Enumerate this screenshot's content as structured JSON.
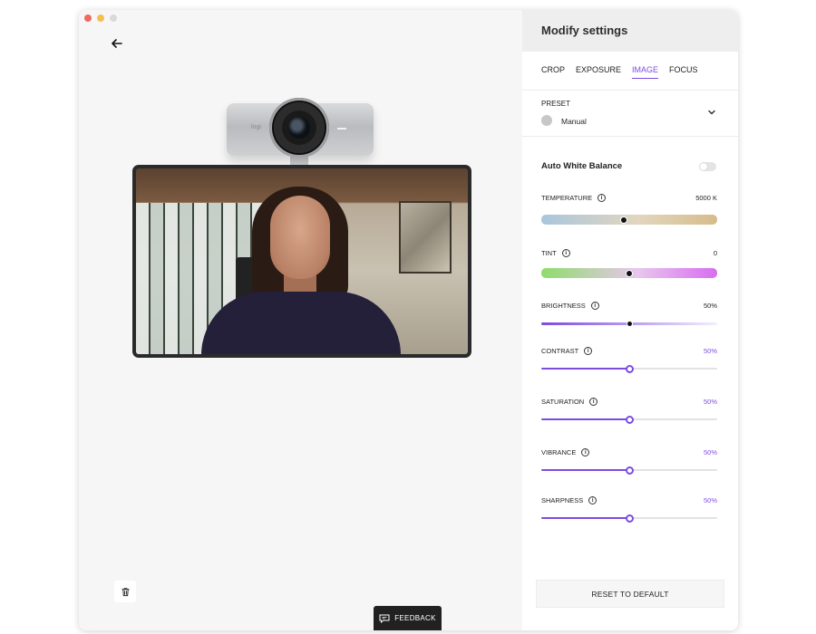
{
  "window": {
    "traffic_colors": [
      "#ec6a5e",
      "#f4bf4f",
      "#d9d9d9"
    ]
  },
  "preview": {
    "camera_logo": "logi",
    "feedback_label": "FEEDBACK"
  },
  "panel": {
    "title": "Modify settings",
    "tabs": [
      {
        "label": "CROP",
        "active": false
      },
      {
        "label": "EXPOSURE",
        "active": false
      },
      {
        "label": "IMAGE",
        "active": true
      },
      {
        "label": "FOCUS",
        "active": false
      }
    ],
    "preset": {
      "label": "PRESET",
      "value": "Manual"
    },
    "auto_white_balance": {
      "label": "Auto White Balance",
      "enabled": false
    },
    "settings": [
      {
        "key": "temperature",
        "label": "TEMPERATURE",
        "value": "5000 K",
        "position": 0.47,
        "accent": false
      },
      {
        "key": "tint",
        "label": "TINT",
        "value": "0",
        "position": 0.5,
        "accent": false
      },
      {
        "key": "brightness",
        "label": "BRIGHTNESS",
        "value": "50%",
        "position": 0.5,
        "accent": false
      },
      {
        "key": "contrast",
        "label": "CONTRAST",
        "value": "50%",
        "position": 0.5,
        "accent": true
      },
      {
        "key": "saturation",
        "label": "SATURATION",
        "value": "50%",
        "position": 0.5,
        "accent": true
      },
      {
        "key": "vibrance",
        "label": "VIBRANCE",
        "value": "50%",
        "position": 0.5,
        "accent": true
      },
      {
        "key": "sharpness",
        "label": "SHARPNESS",
        "value": "50%",
        "position": 0.5,
        "accent": true
      }
    ],
    "reset_label": "RESET TO DEFAULT"
  },
  "colors": {
    "accent": "#7c4cde",
    "temperature_gradient": [
      "#a9c6dc",
      "#e2d6bf",
      "#d6bc8b"
    ],
    "tint_gradient": [
      "#8fdc6b",
      "#e8c6ee",
      "#d86df0"
    ]
  }
}
